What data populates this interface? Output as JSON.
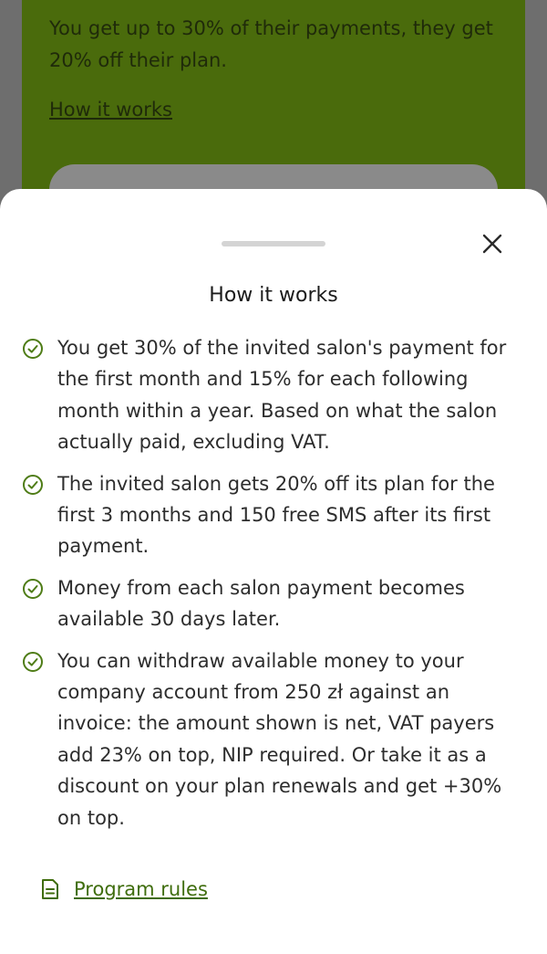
{
  "background": {
    "card_text": "You get up to 30% of their payments, they get 20% off their plan.",
    "link_label": "How it works"
  },
  "sheet": {
    "title": "How it works",
    "items": [
      {
        "text": "You get 30% of the invited salon's payment for the first month and 15% for each following month within a year. Based on what the salon actually paid, excluding VAT."
      },
      {
        "text": "The invited salon gets 20% off its plan for the first 3 months and 150 free SMS after its first payment."
      },
      {
        "text": "Money from each salon payment becomes available 30 days later."
      },
      {
        "text": "You can withdraw available money to your company account from 250 zł against an invoice: the amount shown is net, VAT payers add 23% on top, NIP required. Or take it as a discount on your plan renewals and get +30% on top."
      }
    ],
    "rules_link": "Program rules"
  },
  "colors": {
    "accent": "#3f6d0d",
    "check": "#4e7c16",
    "brand_green": "#5a8a0f"
  },
  "icons": {
    "close": "close-icon",
    "check": "check-circle-icon",
    "document": "document-icon"
  }
}
